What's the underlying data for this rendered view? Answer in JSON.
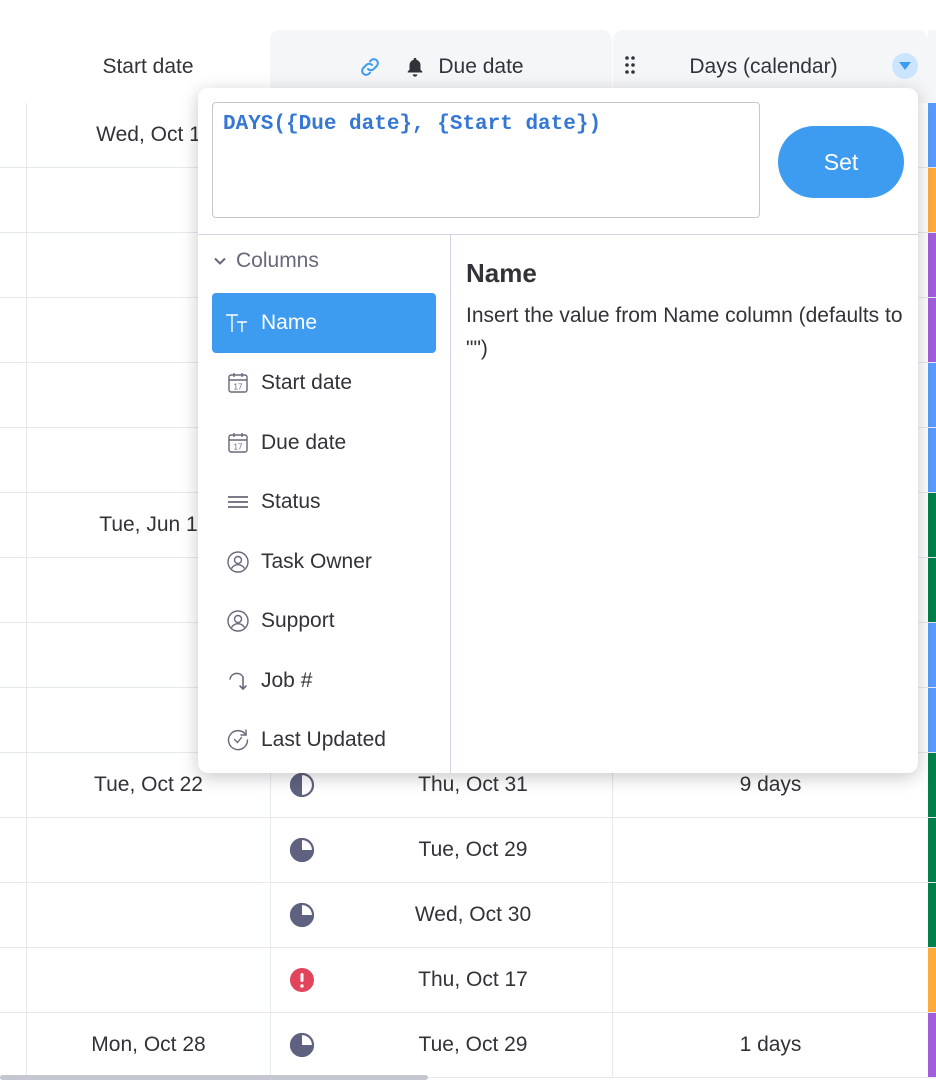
{
  "header": {
    "start_date": "Start date",
    "due_date": "Due date",
    "days_calendar": "Days (calendar)"
  },
  "rows": [
    {
      "start": "Wed, Oct 1",
      "status": "",
      "due": "",
      "days": "",
      "color": "#579bfc"
    },
    {
      "start": "",
      "status": "",
      "due": "",
      "days": "",
      "color": "#fdab3d"
    },
    {
      "start": "",
      "status": "",
      "due": "",
      "days": "",
      "color": "#a25ddc"
    },
    {
      "start": "",
      "status": "",
      "due": "",
      "days": "",
      "color": "#a25ddc"
    },
    {
      "start": "",
      "status": "",
      "due": "",
      "days": "",
      "color": "#579bfc"
    },
    {
      "start": "",
      "status": "",
      "due": "",
      "days": "",
      "color": "#579bfc"
    },
    {
      "start": "Tue, Jun 1",
      "status": "",
      "due": "",
      "days": "",
      "color": "#037f4c"
    },
    {
      "start": "",
      "status": "",
      "due": "",
      "days": "",
      "color": "#037f4c"
    },
    {
      "start": "",
      "status": "",
      "due": "",
      "days": "",
      "color": "#579bfc"
    },
    {
      "start": "",
      "status": "",
      "due": "",
      "days": "",
      "color": "#579bfc"
    },
    {
      "start": "Tue, Oct 22",
      "status": "half",
      "due": "Thu, Oct 31",
      "days": "9 days",
      "color": "#037f4c"
    },
    {
      "start": "",
      "status": "three-quarter",
      "due": "Tue, Oct 29",
      "days": "",
      "color": "#037f4c"
    },
    {
      "start": "",
      "status": "quarter",
      "due": "Wed, Oct 30",
      "days": "",
      "color": "#037f4c"
    },
    {
      "start": "",
      "status": "alert",
      "due": "Thu, Oct 17",
      "days": "",
      "color": "#fdab3d"
    },
    {
      "start": "Mon, Oct 28",
      "status": "three-quarter",
      "due": "Tue, Oct 29",
      "days": "1 days",
      "color": "#a25ddc"
    }
  ],
  "popup": {
    "formula": "DAYS({Due date}, {Start date})",
    "set_label": "Set",
    "section_label": "Columns",
    "columns": [
      {
        "label": "Name",
        "icon": "text-type-icon",
        "active": true
      },
      {
        "label": "Start date",
        "icon": "calendar-icon"
      },
      {
        "label": "Due date",
        "icon": "calendar-icon"
      },
      {
        "label": "Status",
        "icon": "status-lines-icon"
      },
      {
        "label": "Task Owner",
        "icon": "person-icon"
      },
      {
        "label": "Support",
        "icon": "person-icon"
      },
      {
        "label": "Job #",
        "icon": "autonumber-icon"
      },
      {
        "label": "Last Updated",
        "icon": "last-updated-icon"
      }
    ],
    "detail_title": "Name",
    "detail_text": "Insert the value from Name column (defaults to \"\")"
  },
  "colors": {
    "accent": "#3d9bf0",
    "formula_text": "#3577d4",
    "status_icon": "#5f6180",
    "alert": "#e2445c"
  }
}
